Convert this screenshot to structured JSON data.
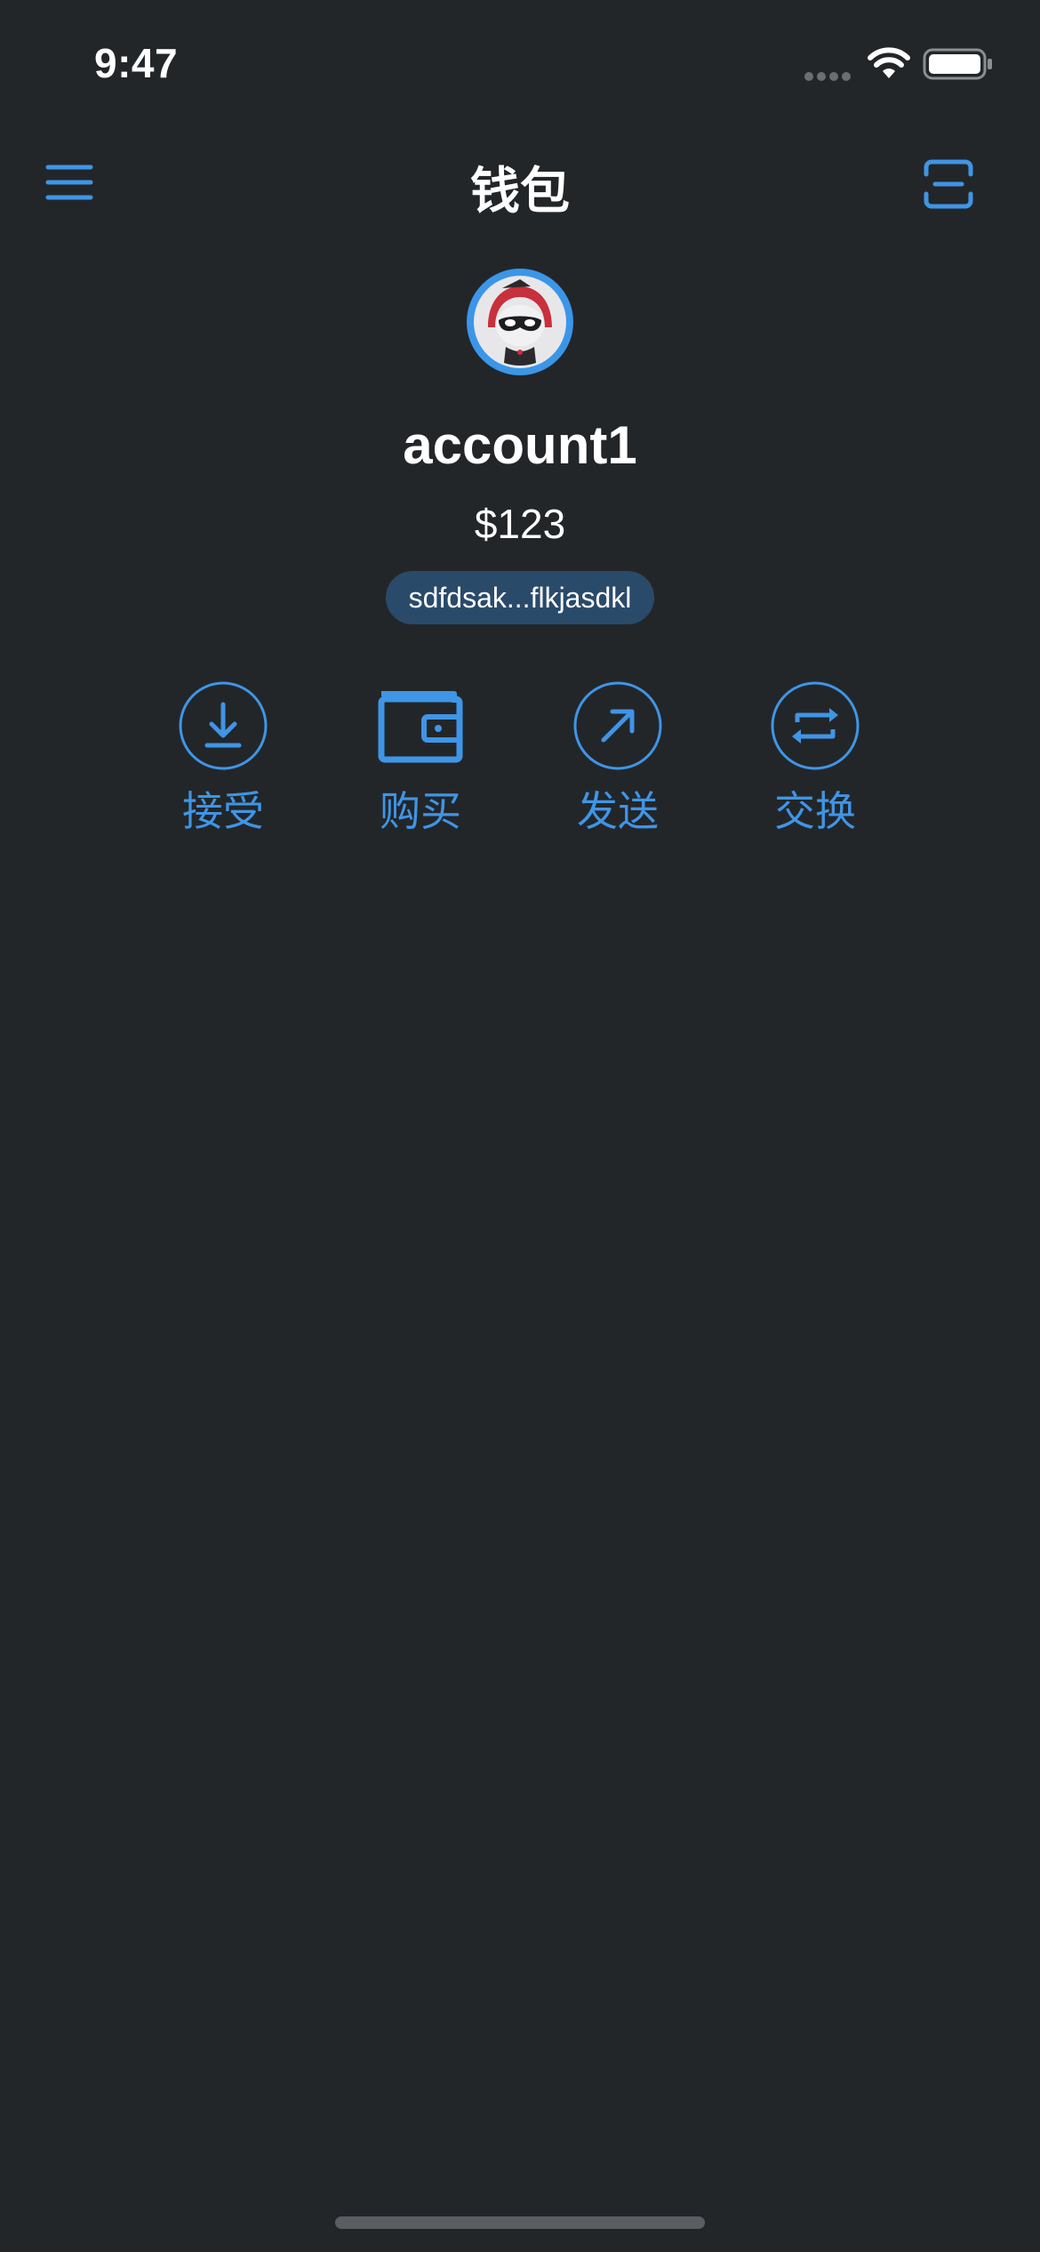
{
  "status_bar": {
    "time": "9:47"
  },
  "nav": {
    "title": "钱包",
    "menu_icon": "hamburger-menu-icon",
    "scan_icon": "scan-icon"
  },
  "account": {
    "name": "account1",
    "balance": "$123",
    "address": "sdfdsak...flkjasdkl"
  },
  "actions": [
    {
      "label": "接受",
      "icon": "receive-download-icon"
    },
    {
      "label": "购买",
      "icon": "wallet-icon"
    },
    {
      "label": "发送",
      "icon": "send-arrow-icon"
    },
    {
      "label": "交换",
      "icon": "swap-icon"
    }
  ],
  "colors": {
    "background": "#232629",
    "accent": "#3f95e6",
    "address_pill": "#2a4a6a"
  }
}
